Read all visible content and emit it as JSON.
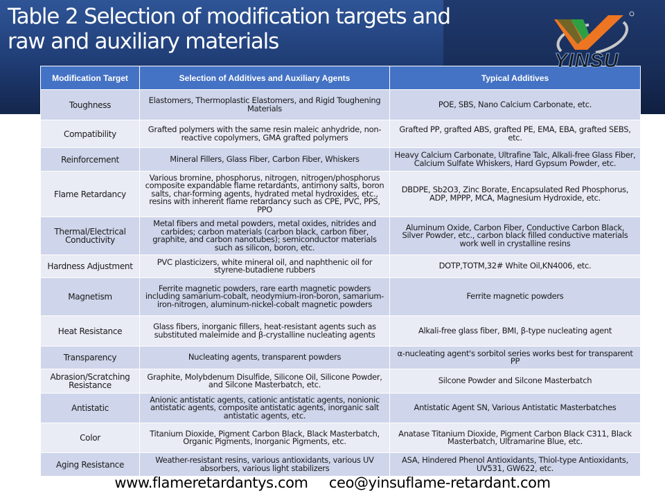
{
  "title": "Table 2 Selection of modification targets and raw and auxiliary materials",
  "logo": {
    "text": "YINSU",
    "icon": "yinsu-logo-icon",
    "colors": {
      "green": "#2ea043",
      "orange": "#ee7623",
      "ring": "#c0c0c0"
    }
  },
  "table": {
    "headers": [
      "Modification Target",
      "Selection of Additives and Auxiliary Agents",
      "Typical Additives"
    ],
    "header_color": "#4472c4",
    "rows": [
      {
        "target": "Toughness",
        "selection": "Elastomers, Thermoplastic Elastomers, and Rigid Toughening Materials",
        "typical": "POE, SBS, Nano Calcium Carbonate, etc."
      },
      {
        "target": "Compatibility",
        "selection": "Grafted polymers with the same resin maleic anhydride, non-reactive copolymers, GMA grafted polymers",
        "typical": "Grafted PP, grafted ABS, grafted PE, EMA, EBA, grafted SEBS, etc."
      },
      {
        "target": "Reinforcement",
        "selection": "Mineral Fillers, Glass Fiber, Carbon Fiber, Whiskers",
        "typical": "Heavy Calcium Carbonate, Ultrafine Talc, Alkali-free Glass Fiber, Calcium Sulfate Whiskers, Hard Gypsum Powder, etc."
      },
      {
        "target": "Flame Retardancy",
        "selection": "Various bromine, phosphorus, nitrogen, nitrogen/phosphorus composite expandable flame retardants, antimony salts, boron salts, char-forming agents, hydrated metal hydroxides, etc., resins with inherent flame retardancy such as CPE, PVC, PPS, PPO",
        "typical": "DBDPE, Sb2O3, Zinc Borate, Encapsulated Red Phosphorus, ADP, MPPP, MCA, Magnesium Hydroxide, etc."
      },
      {
        "target": "Thermal/Electrical Conductivity",
        "selection": "Metal fibers and metal powders, metal oxides, nitrides and carbides; carbon materials (carbon black, carbon fiber, graphite, and carbon nanotubes); semiconductor materials such as silicon, boron, etc.",
        "typical": "Aluminum Oxide, Carbon Fiber, Conductive Carbon Black, Silver Powder, etc., carbon black filled conductive materials work well in crystalline resins"
      },
      {
        "target": "Hardness Adjustment",
        "selection": "PVC plasticizers, white mineral oil, and naphthenic oil for styrene-butadiene rubbers",
        "typical": "DOTP,TOTM,32# White Oil,KN4006, etc."
      },
      {
        "target": "Magnetism",
        "selection": "Ferrite magnetic powders, rare earth magnetic powders including samarium-cobalt, neodymium-iron-boron, samarium-iron-nitrogen, aluminum-nickel-cobalt magnetic powders",
        "typical": "Ferrite magnetic powders"
      },
      {
        "target": "Heat Resistance",
        "selection": "Glass fibers, inorganic fillers, heat-resistant agents such as substituted maleimide and β-crystalline nucleating agents",
        "typical": "Alkali-free glass fiber, BMI, β-type nucleating agent"
      },
      {
        "target": "Transparency",
        "selection": "Nucleating agents, transparent powders",
        "typical": "α-nucleating agent's sorbitol series works best for transparent PP"
      },
      {
        "target": "Abrasion/Scratching Resistance",
        "selection": "Graphite, Molybdenum Disulfide, Silicone Oil, Silicone Powder, and Silcone Masterbatch, etc.",
        "typical": "Silcone Powder and Silcone Masterbatch"
      },
      {
        "target": "Antistatic",
        "selection": "Anionic antistatic agents, cationic antistatic agents, nonionic antistatic agents, composite antistatic agents, inorganic salt antistatic agents, etc.",
        "typical": "Antistatic Agent SN, Various Antistatic Masterbatches"
      },
      {
        "target": "Color",
        "selection": "Titanium Dioxide, Pigment Carbon Black, Black Masterbatch, Organic Pigments, Inorganic Pigments, etc.",
        "typical": "Anatase Titanium Dioxide, Pigment Carbon Black C311, Black Masterbatch, Ultramarine Blue, etc."
      },
      {
        "target": "Aging Resistance",
        "selection": "Weather-resistant resins, various antioxidants, various UV absorbers, various light stabilizers",
        "typical": "ASA, Hindered Phenol Antioxidants, Thiol-type Antioxidants, UV531, GW622, etc."
      }
    ]
  },
  "footer": {
    "website": "www.flameretardantys.com",
    "email": "ceo@yinsuflame-retardant.com"
  }
}
